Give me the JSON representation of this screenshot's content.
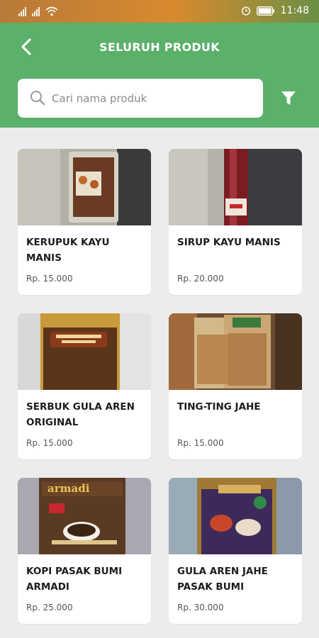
{
  "status_bar": {
    "time": "11:48"
  },
  "header": {
    "title": "SELURUH PRODUK"
  },
  "search": {
    "placeholder": "Cari nama produk"
  },
  "products": [
    {
      "name": "KERUPUK KAYU MANIS",
      "price": "Rp. 15.000"
    },
    {
      "name": "SIRUP KAYU MANIS",
      "price": "Rp. 20.000"
    },
    {
      "name": "SERBUK GULA AREN ORIGINAL",
      "price": "Rp. 15.000"
    },
    {
      "name": "TING-TING JAHE",
      "price": "Rp. 15.000"
    },
    {
      "name": "KOPI PASAK BUMI ARMADI",
      "price": "Rp. 25.000"
    },
    {
      "name": "GULA AREN JAHE PASAK BUMI",
      "price": "Rp. 30.000"
    }
  ],
  "colors": {
    "primary": "#5bb06a",
    "background": "#ececec",
    "card": "#ffffff"
  },
  "package_labels": {
    "armadi": "armadi"
  }
}
